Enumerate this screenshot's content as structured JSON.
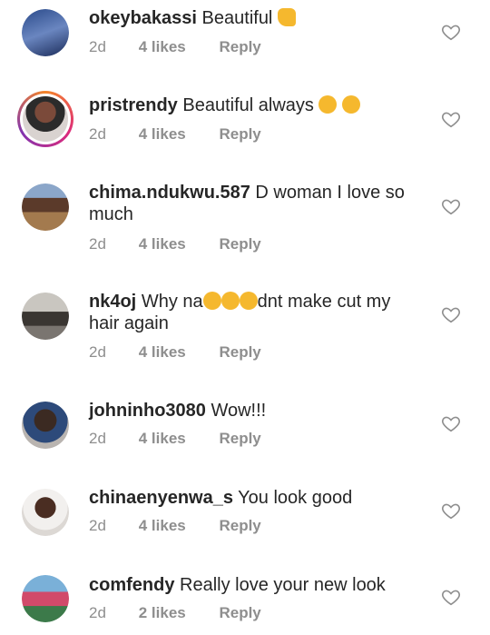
{
  "comments": [
    {
      "user": "okeybakassi",
      "text": "Beautiful",
      "emoji": "thumbs-up",
      "time": "2d",
      "likes": "4 likes",
      "reply": "Reply"
    },
    {
      "user": "pristrendy",
      "text": "Beautiful always",
      "emoji": "ok-hand x2",
      "time": "2d",
      "likes": "4 likes",
      "reply": "Reply"
    },
    {
      "user": "chima.ndukwu.587",
      "text": "D woman I love so",
      "text2": "much",
      "time": "2d",
      "likes": "4 likes",
      "reply": "Reply"
    },
    {
      "user": "nk4oj",
      "text": "Why na",
      "text_after": "dnt make cut my",
      "text2": "hair again",
      "emoji": "crying-face x3",
      "time": "2d",
      "likes": "4 likes",
      "reply": "Reply"
    },
    {
      "user": "johninho3080",
      "text": "Wow!!!",
      "time": "2d",
      "likes": "4 likes",
      "reply": "Reply"
    },
    {
      "user": "chinaenyenwa_s",
      "text": "You look good",
      "time": "2d",
      "likes": "4 likes",
      "reply": "Reply"
    },
    {
      "user": "comfendy",
      "text": "Really love your new look",
      "time": "2d",
      "likes": "2 likes",
      "reply": "Reply"
    }
  ],
  "colors": {
    "text": "#262626",
    "muted": "#8e8e8e",
    "emoji": "#f5b82e"
  }
}
